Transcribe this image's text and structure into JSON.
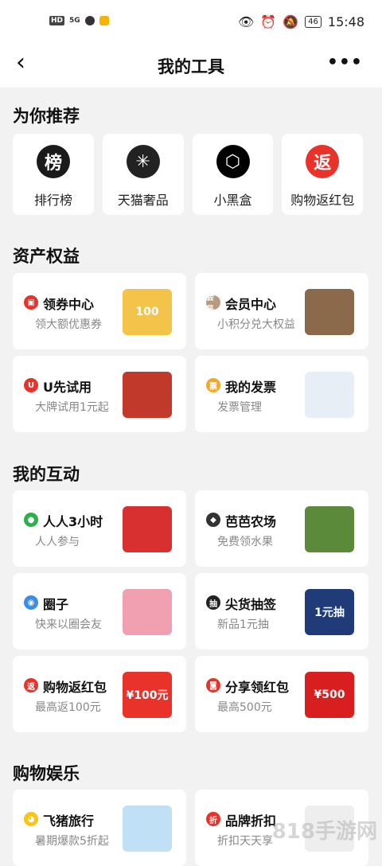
{
  "status_bar": {
    "hd": "HD",
    "network": "5G",
    "time": "15:48",
    "battery": "46"
  },
  "nav": {
    "back": "‹",
    "title": "我的工具",
    "more": "•••"
  },
  "sections": {
    "recommend": "为你推荐",
    "assets": "资产权益",
    "interact": "我的互动",
    "shopping": "购物娱乐"
  },
  "recommend": [
    {
      "icon": "rank-icon",
      "glyph": "榜",
      "label": "排行榜",
      "color": "#1a1a1a"
    },
    {
      "icon": "tmall-luxury-icon",
      "glyph": "✳",
      "label": "天猫奢品",
      "color": "#222"
    },
    {
      "icon": "black-box-icon",
      "glyph": "⬡",
      "label": "小黑盒",
      "color": "#000"
    },
    {
      "icon": "cashback-icon",
      "glyph": "返",
      "label": "购物返红包",
      "color": "#e8322a"
    }
  ],
  "assets": [
    {
      "title": "领券中心",
      "sub": "领大额优惠券",
      "badge": "▣",
      "badge_color": "#e8322a",
      "pic_color": "#f4c34a",
      "pic_text": "100"
    },
    {
      "title": "会员中心",
      "sub": "小积分兑大权益",
      "badge": "会员",
      "badge_color": "#b89a80",
      "pic_color": "#8a6a4a",
      "pic_text": ""
    },
    {
      "title": "U先试用",
      "sub": "大牌试用1元起",
      "badge": "U",
      "badge_color": "#e8322a",
      "pic_color": "#c0392b",
      "pic_text": ""
    },
    {
      "title": "我的发票",
      "sub": "发票管理",
      "badge": "票",
      "badge_color": "#f5a623",
      "pic_color": "#e8eef6",
      "pic_text": ""
    }
  ],
  "interact": [
    {
      "title": "人人3小时",
      "sub": "人人参与",
      "badge": "●",
      "badge_color": "#2ab24a",
      "pic_color": "#d83030",
      "pic_text": ""
    },
    {
      "title": "芭芭农场",
      "sub": "免费领水果",
      "badge": "◆",
      "badge_color": "#333",
      "pic_color": "#5a8a3a",
      "pic_text": ""
    },
    {
      "title": "圈子",
      "sub": "快来以圈会友",
      "badge": "◉",
      "badge_color": "#3a8ee6",
      "pic_color": "#f0a0b0",
      "pic_text": ""
    },
    {
      "title": "尖货抽签",
      "sub": "新品1元抽",
      "badge": "抽",
      "badge_color": "#222",
      "pic_color": "#1f3c78",
      "pic_text": "1元抽"
    },
    {
      "title": "购物返红包",
      "sub": "最高返100元",
      "badge": "返",
      "badge_color": "#e8322a",
      "pic_color": "#e8322a",
      "pic_text": "¥100元"
    },
    {
      "title": "分享领红包",
      "sub": "最高500元",
      "badge": "◙",
      "badge_color": "#e8322a",
      "pic_color": "#d81e1e",
      "pic_text": "¥500"
    }
  ],
  "shopping": [
    {
      "title": "飞猪旅行",
      "sub": "暑期爆款5折起",
      "badge": "◕",
      "badge_color": "#f5c518",
      "pic_color": "#bfe0f5",
      "pic_text": ""
    },
    {
      "title": "品牌折扣",
      "sub": "折扣天天享",
      "badge": "折",
      "badge_color": "#e8322a",
      "pic_color": "#eeeeee",
      "pic_text": ""
    }
  ],
  "watermark": "818手游网"
}
